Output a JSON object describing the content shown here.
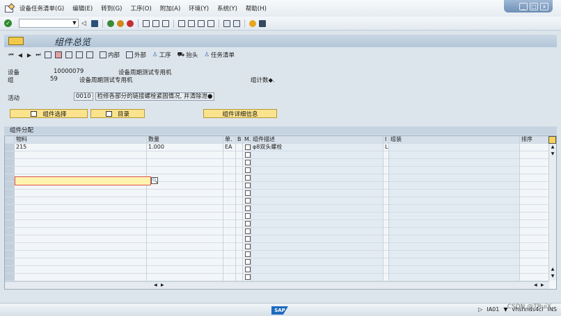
{
  "menu": [
    "设备任务清单(G)",
    "编辑(E)",
    "转到(G)",
    "工序(O)",
    "附加(A)",
    "环境(Y)",
    "系统(Y)",
    "帮助(H)"
  ],
  "window_controls": [
    "_",
    "□",
    "x"
  ],
  "title": "组件总览",
  "app_toolbar": {
    "internal": "内部",
    "external": "外部",
    "operation": "工序",
    "header": "抬头",
    "task_list": "任务清单"
  },
  "header": {
    "equipment_label": "设备",
    "equipment_value": "10000079",
    "equipment_desc": "设备周期测试专用机",
    "group_label": "组",
    "group_value": "59",
    "group_desc": "设备周期测试专用机",
    "counter_label": "组计数◆.",
    "activity_label": "活动",
    "activity_value": "0010",
    "activity_desc": "检修各部分的链接螺栓紧固情况, 并清除泄●"
  },
  "buttons": {
    "component_select": "组件选择",
    "catalog": "目录",
    "component_detail": "组件详细信息"
  },
  "table": {
    "title": "组件分配",
    "columns": [
      "物料",
      "数量",
      "单.",
      "B",
      "M.",
      "组件描述",
      "I",
      "组装",
      "排序"
    ],
    "rows": [
      {
        "material": "215",
        "quantity": "1.000",
        "unit": "EA",
        "desc": "φ8双头螺栓",
        "item_cat": "L"
      }
    ]
  },
  "status": {
    "logo": "SAP",
    "system": "IA01",
    "server": "vhshnds4ci",
    "mode": "INS"
  },
  "watermark": "CSDN @TRuiX"
}
